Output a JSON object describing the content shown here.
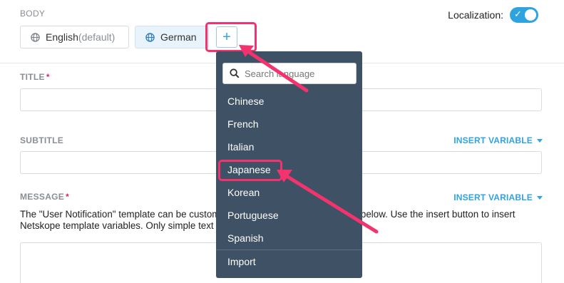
{
  "body_label": "BODY",
  "localization": {
    "label": "Localization:",
    "enabled": true,
    "toggle_color": "#2fa3e0"
  },
  "language_tabs": [
    {
      "name": "English",
      "suffix": "(default)"
    },
    {
      "name": "German",
      "suffix": ""
    }
  ],
  "add_button": {
    "symbol": "+"
  },
  "title_field": {
    "label": "TITLE",
    "required": "*"
  },
  "subtitle_field": {
    "label": "SUBTITLE",
    "insert_variable": "INSERT VARIABLE"
  },
  "message_field": {
    "label": "MESSAGE",
    "required": "*",
    "insert_variable": "INSERT VARIABLE",
    "description": "The \"User Notification\" template can be customized by directly editing the HTML below. Use the insert button to insert Netskope template variables. Only simple text and links are supported."
  },
  "language_dropdown": {
    "search_placeholder": "Search language",
    "items": [
      "Chinese",
      "French",
      "Italian",
      "Japanese",
      "Korean",
      "Portuguese",
      "Spanish"
    ],
    "highlighted": "Japanese",
    "footer_item": "Import",
    "background": "#3e5165"
  },
  "colors": {
    "accent": "#2fa3e0",
    "annotation": "#f2336d"
  }
}
